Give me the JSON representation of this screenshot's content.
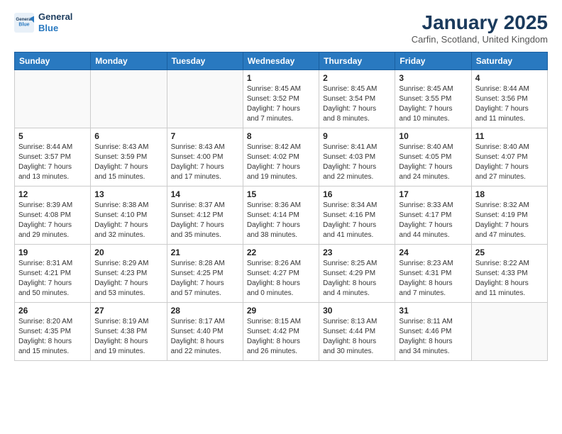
{
  "logo": {
    "line1": "General",
    "line2": "Blue"
  },
  "title": "January 2025",
  "subtitle": "Carfin, Scotland, United Kingdom",
  "days_of_week": [
    "Sunday",
    "Monday",
    "Tuesday",
    "Wednesday",
    "Thursday",
    "Friday",
    "Saturday"
  ],
  "weeks": [
    [
      {
        "day": "",
        "info": ""
      },
      {
        "day": "",
        "info": ""
      },
      {
        "day": "",
        "info": ""
      },
      {
        "day": "1",
        "info": "Sunrise: 8:45 AM\nSunset: 3:52 PM\nDaylight: 7 hours\nand 7 minutes."
      },
      {
        "day": "2",
        "info": "Sunrise: 8:45 AM\nSunset: 3:54 PM\nDaylight: 7 hours\nand 8 minutes."
      },
      {
        "day": "3",
        "info": "Sunrise: 8:45 AM\nSunset: 3:55 PM\nDaylight: 7 hours\nand 10 minutes."
      },
      {
        "day": "4",
        "info": "Sunrise: 8:44 AM\nSunset: 3:56 PM\nDaylight: 7 hours\nand 11 minutes."
      }
    ],
    [
      {
        "day": "5",
        "info": "Sunrise: 8:44 AM\nSunset: 3:57 PM\nDaylight: 7 hours\nand 13 minutes."
      },
      {
        "day": "6",
        "info": "Sunrise: 8:43 AM\nSunset: 3:59 PM\nDaylight: 7 hours\nand 15 minutes."
      },
      {
        "day": "7",
        "info": "Sunrise: 8:43 AM\nSunset: 4:00 PM\nDaylight: 7 hours\nand 17 minutes."
      },
      {
        "day": "8",
        "info": "Sunrise: 8:42 AM\nSunset: 4:02 PM\nDaylight: 7 hours\nand 19 minutes."
      },
      {
        "day": "9",
        "info": "Sunrise: 8:41 AM\nSunset: 4:03 PM\nDaylight: 7 hours\nand 22 minutes."
      },
      {
        "day": "10",
        "info": "Sunrise: 8:40 AM\nSunset: 4:05 PM\nDaylight: 7 hours\nand 24 minutes."
      },
      {
        "day": "11",
        "info": "Sunrise: 8:40 AM\nSunset: 4:07 PM\nDaylight: 7 hours\nand 27 minutes."
      }
    ],
    [
      {
        "day": "12",
        "info": "Sunrise: 8:39 AM\nSunset: 4:08 PM\nDaylight: 7 hours\nand 29 minutes."
      },
      {
        "day": "13",
        "info": "Sunrise: 8:38 AM\nSunset: 4:10 PM\nDaylight: 7 hours\nand 32 minutes."
      },
      {
        "day": "14",
        "info": "Sunrise: 8:37 AM\nSunset: 4:12 PM\nDaylight: 7 hours\nand 35 minutes."
      },
      {
        "day": "15",
        "info": "Sunrise: 8:36 AM\nSunset: 4:14 PM\nDaylight: 7 hours\nand 38 minutes."
      },
      {
        "day": "16",
        "info": "Sunrise: 8:34 AM\nSunset: 4:16 PM\nDaylight: 7 hours\nand 41 minutes."
      },
      {
        "day": "17",
        "info": "Sunrise: 8:33 AM\nSunset: 4:17 PM\nDaylight: 7 hours\nand 44 minutes."
      },
      {
        "day": "18",
        "info": "Sunrise: 8:32 AM\nSunset: 4:19 PM\nDaylight: 7 hours\nand 47 minutes."
      }
    ],
    [
      {
        "day": "19",
        "info": "Sunrise: 8:31 AM\nSunset: 4:21 PM\nDaylight: 7 hours\nand 50 minutes."
      },
      {
        "day": "20",
        "info": "Sunrise: 8:29 AM\nSunset: 4:23 PM\nDaylight: 7 hours\nand 53 minutes."
      },
      {
        "day": "21",
        "info": "Sunrise: 8:28 AM\nSunset: 4:25 PM\nDaylight: 7 hours\nand 57 minutes."
      },
      {
        "day": "22",
        "info": "Sunrise: 8:26 AM\nSunset: 4:27 PM\nDaylight: 8 hours\nand 0 minutes."
      },
      {
        "day": "23",
        "info": "Sunrise: 8:25 AM\nSunset: 4:29 PM\nDaylight: 8 hours\nand 4 minutes."
      },
      {
        "day": "24",
        "info": "Sunrise: 8:23 AM\nSunset: 4:31 PM\nDaylight: 8 hours\nand 7 minutes."
      },
      {
        "day": "25",
        "info": "Sunrise: 8:22 AM\nSunset: 4:33 PM\nDaylight: 8 hours\nand 11 minutes."
      }
    ],
    [
      {
        "day": "26",
        "info": "Sunrise: 8:20 AM\nSunset: 4:35 PM\nDaylight: 8 hours\nand 15 minutes."
      },
      {
        "day": "27",
        "info": "Sunrise: 8:19 AM\nSunset: 4:38 PM\nDaylight: 8 hours\nand 19 minutes."
      },
      {
        "day": "28",
        "info": "Sunrise: 8:17 AM\nSunset: 4:40 PM\nDaylight: 8 hours\nand 22 minutes."
      },
      {
        "day": "29",
        "info": "Sunrise: 8:15 AM\nSunset: 4:42 PM\nDaylight: 8 hours\nand 26 minutes."
      },
      {
        "day": "30",
        "info": "Sunrise: 8:13 AM\nSunset: 4:44 PM\nDaylight: 8 hours\nand 30 minutes."
      },
      {
        "day": "31",
        "info": "Sunrise: 8:11 AM\nSunset: 4:46 PM\nDaylight: 8 hours\nand 34 minutes."
      },
      {
        "day": "",
        "info": ""
      }
    ]
  ]
}
